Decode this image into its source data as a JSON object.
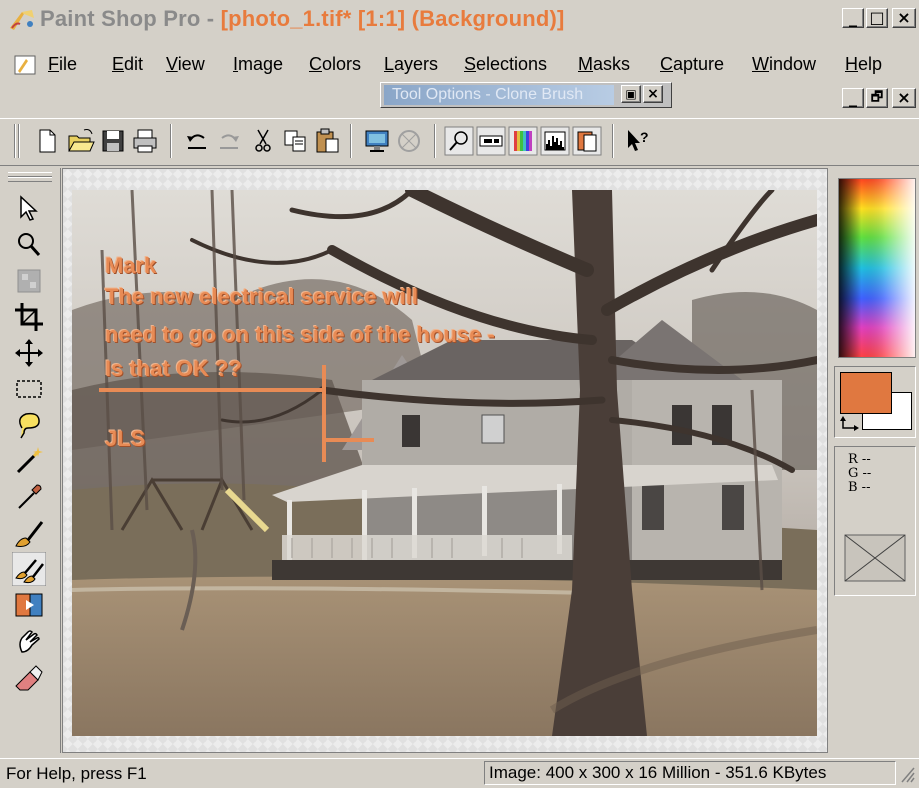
{
  "window": {
    "title_app": "Paint Shop Pro - ",
    "title_doc": "[photo_1.tif* [1:1] (Background)]",
    "controls": [
      "_",
      "□",
      "×"
    ],
    "mdi_controls": [
      "_",
      "🗗",
      "×"
    ]
  },
  "menu": {
    "items": [
      {
        "label_u": "F",
        "label_rest": "ile"
      },
      {
        "label_u": "E",
        "label_rest": "dit"
      },
      {
        "label_u": "V",
        "label_rest": "iew"
      },
      {
        "label_u": "I",
        "label_rest": "mage"
      },
      {
        "label_u": "C",
        "label_rest": "olors"
      },
      {
        "label_u": "L",
        "label_rest": "ayers"
      },
      {
        "label_u": "S",
        "label_rest": "elections"
      },
      {
        "label_u": "M",
        "label_rest": "asks"
      },
      {
        "label_u": "C",
        "label_rest": "apture"
      },
      {
        "label_u": "W",
        "label_rest": "indow"
      },
      {
        "label_u": "H",
        "label_rest": "elp"
      }
    ]
  },
  "tool_options": {
    "title": "Tool Options - Clone Brush"
  },
  "annotation": {
    "line1": "Mark",
    "line2": "The new electrical service will",
    "line3": "need to go on this side of the house -",
    "line4": "Is that OK ??",
    "signature": "JLS",
    "color": "#e88b55"
  },
  "color_palette": {
    "foreground": "#e07840",
    "background": "#ffffff",
    "r_label": "R --",
    "g_label": "G --",
    "b_label": "B --"
  },
  "status": {
    "help": "For Help, press F1",
    "image_info": "Image:  400 x 300 x 16 Million - 351.6 KBytes"
  }
}
